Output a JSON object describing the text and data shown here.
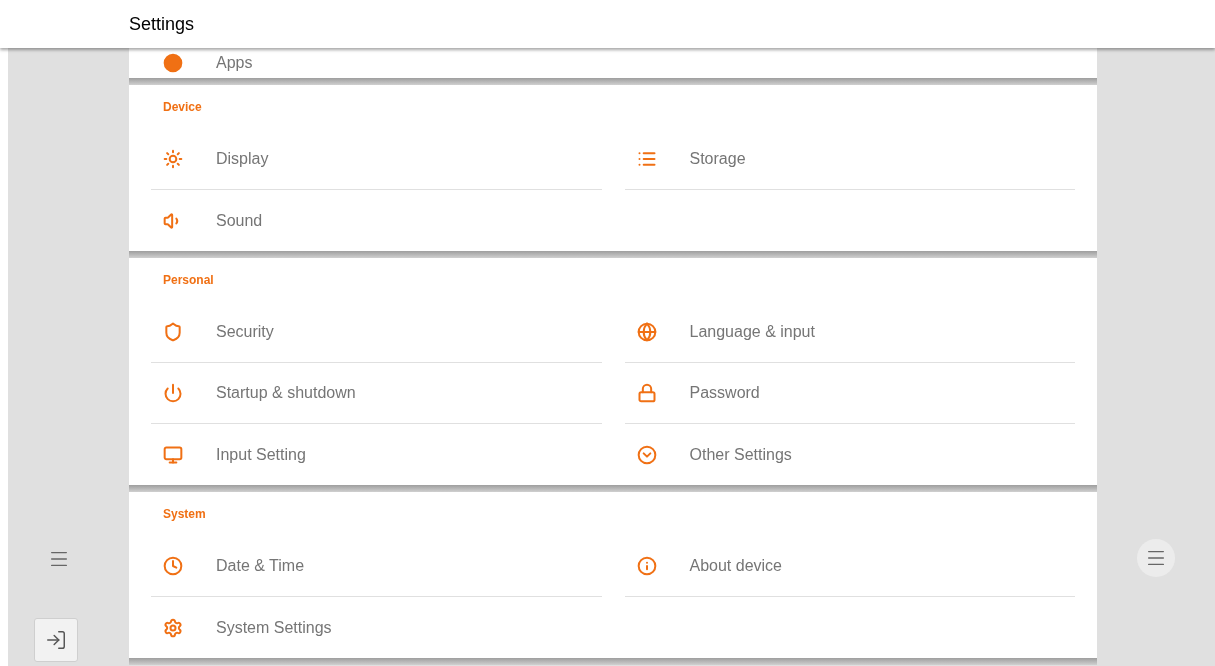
{
  "header": {
    "title": "Settings"
  },
  "sections": [
    {
      "items": [
        {
          "label": "Apps"
        }
      ]
    },
    {
      "title": "Device",
      "items": [
        {
          "label": "Display"
        },
        {
          "label": "Storage"
        },
        {
          "label": "Sound"
        }
      ]
    },
    {
      "title": "Personal",
      "items": [
        {
          "label": "Security"
        },
        {
          "label": "Language & input"
        },
        {
          "label": "Startup & shutdown"
        },
        {
          "label": "Password"
        },
        {
          "label": "Input Setting"
        },
        {
          "label": "Other Settings"
        }
      ]
    },
    {
      "title": "System",
      "items": [
        {
          "label": "Date & Time"
        },
        {
          "label": "About device"
        },
        {
          "label": "System Settings"
        }
      ]
    }
  ]
}
